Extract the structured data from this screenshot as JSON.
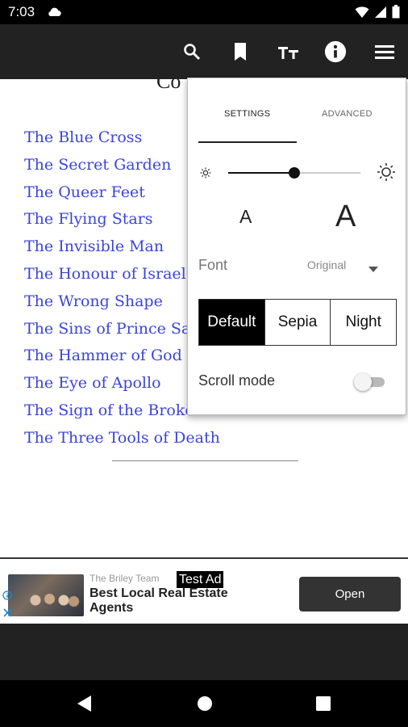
{
  "status_bar": {
    "time": "7:03"
  },
  "toolbar": {
    "icons": [
      "search-icon",
      "bookmark-icon",
      "font-size-icon",
      "info-icon",
      "menu-icon"
    ]
  },
  "book": {
    "title_visible": "Co",
    "chapters": [
      "The Blue Cross",
      "The Secret Garden",
      "The Queer Feet",
      "The Flying Stars",
      "The Invisible Man",
      "The Honour of Israel G",
      "The Wrong Shape",
      "The Sins of Prince Sar",
      "The Hammer of God",
      "The Eye of Apollo",
      "The Sign of the Broke",
      "The Three Tools of Death"
    ],
    "link_color": "#3b45d6"
  },
  "settings": {
    "tabs": [
      "SETTINGS",
      "ADVANCED"
    ],
    "active_tab": "SETTINGS",
    "brightness_level": 0.5,
    "font_size_small": "A",
    "font_size_large": "A",
    "font_label": "Font",
    "font_value": "Original",
    "themes": [
      "Default",
      "Sepia",
      "Night"
    ],
    "active_theme": "Default",
    "scroll_mode_label": "Scroll mode",
    "scroll_mode_on": false
  },
  "ad": {
    "advertiser": "The Briley Team",
    "test_tag": "Test Ad",
    "headline": "Best Local Real Estate Agents",
    "cta": "Open"
  }
}
